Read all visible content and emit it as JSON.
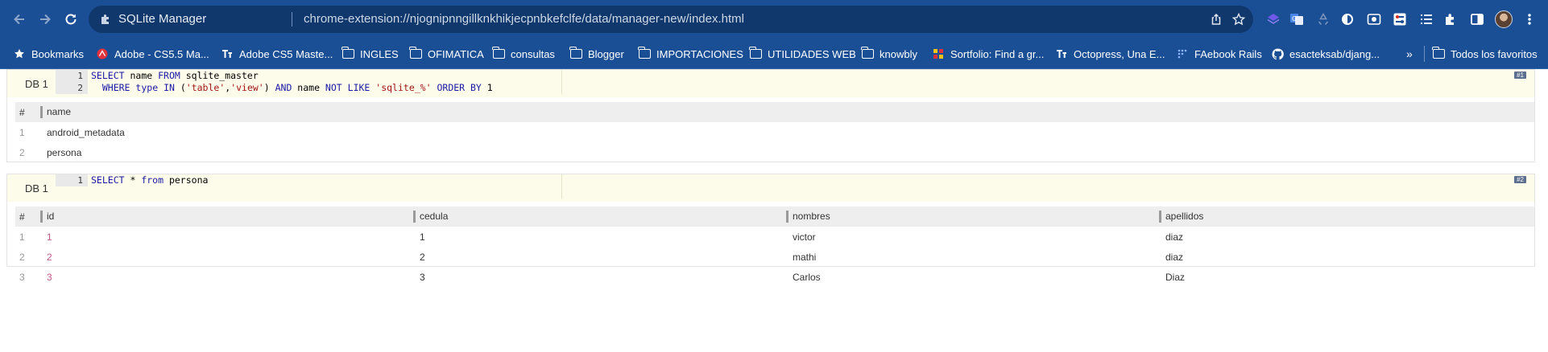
{
  "browser": {
    "site_name": "SQLite Manager",
    "url": "chrome-extension://njognipnngillknkhikjecpnbkefclfe/data/manager-new/index.html"
  },
  "bookmarks": {
    "items": [
      {
        "label": "Bookmarks",
        "icon": "star-icon"
      },
      {
        "label": "Adobe - CS5.5 Ma...",
        "icon": "adobe-icon"
      },
      {
        "label": "Adobe CS5 Maste...",
        "icon": "site-icon"
      },
      {
        "label": "INGLES",
        "icon": "folder-icon"
      },
      {
        "label": "OFIMATICA",
        "icon": "folder-icon"
      },
      {
        "label": "consultas",
        "icon": "folder-icon"
      },
      {
        "label": "Blogger",
        "icon": "folder-icon"
      },
      {
        "label": "IMPORTACIONES",
        "icon": "folder-icon"
      },
      {
        "label": "UTILIDADES WEB",
        "icon": "folder-icon"
      },
      {
        "label": "knowbly",
        "icon": "folder-icon"
      },
      {
        "label": "Sortfolio: Find a gr...",
        "icon": "grid-icon"
      },
      {
        "label": "Octopress, Una E...",
        "icon": "site-icon"
      },
      {
        "label": "FAebook Rails",
        "icon": "dots-icon"
      },
      {
        "label": "esacteksab/djang...",
        "icon": "github-icon"
      }
    ],
    "overflow_label": "»",
    "all_bookmarks_label": "Todos los favoritos"
  },
  "queries": [
    {
      "db_label": "DB 1",
      "badge": "#1",
      "lines": [
        {
          "num": "1"
        },
        {
          "num": "2"
        }
      ],
      "columns": [
        "#",
        "name"
      ],
      "rows": [
        {
          "n": "1",
          "cells": [
            "android_metadata"
          ]
        },
        {
          "n": "2",
          "cells": [
            "persona"
          ]
        }
      ]
    },
    {
      "db_label": "DB 1",
      "badge": "#2",
      "lines": [
        {
          "num": "1"
        }
      ],
      "columns": [
        "#",
        "id",
        "cedula",
        "nombres",
        "apellidos"
      ],
      "rows": [
        {
          "n": "1",
          "cells": [
            "1",
            "1",
            "victor",
            "diaz"
          ]
        },
        {
          "n": "2",
          "cells": [
            "2",
            "2",
            "mathi",
            "diaz"
          ]
        },
        {
          "n": "3",
          "cells": [
            "3",
            "3",
            "Carlos",
            "Diaz"
          ]
        }
      ]
    }
  ],
  "colors": {
    "chrome_blue": "#1a4f96",
    "omnibox": "#10386c",
    "editor_bg": "#fdfcea",
    "keyword": "#1a1aa6",
    "string": "#a31515",
    "id_value": "#c25a8a"
  }
}
